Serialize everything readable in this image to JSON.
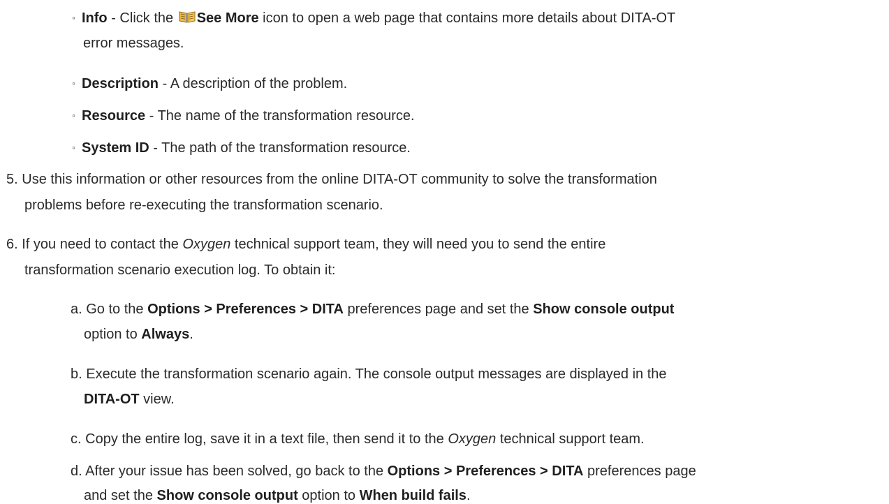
{
  "bullets": {
    "info": {
      "term": "Info",
      "pre": " - Click the ",
      "icon": "book-icon",
      "icon_label": "See More",
      "post1": " icon to open a web page that contains more details about DITA-OT",
      "post2": "error messages."
    },
    "description": {
      "term": "Description",
      "text": " - A description of the problem."
    },
    "resource": {
      "term": "Resource",
      "text": " - The name of the transformation resource."
    },
    "system_id": {
      "term": "System ID",
      "text": " - The path of the transformation resource."
    }
  },
  "step5": {
    "num": "5.",
    "line1": "Use this information or other resources from the online DITA-OT community to solve the transformation",
    "line2": "problems before re-executing the transformation scenario."
  },
  "step6": {
    "num": "6.",
    "l1_pre": "If you need to contact the ",
    "l1_em": "Oxygen",
    "l1_post": " technical support team, they will need you to send the entire",
    "line2": "transformation scenario execution log. To obtain it:"
  },
  "substeps": {
    "a": {
      "marker": "a.",
      "pre": "Go to the ",
      "menu": "Options > Preferences > DITA",
      "mid": " preferences page and set the ",
      "option": "Show console output",
      "l2_pre": "option to ",
      "value": "Always",
      "l2_post": "."
    },
    "b": {
      "marker": "b.",
      "line1": "Execute the transformation scenario again. The console output messages are displayed in the",
      "view": "DITA-OT",
      "l2_post": " view."
    },
    "c": {
      "marker": "c.",
      "pre": "Copy the entire log, save it in a text file, then send it to the ",
      "em": "Oxygen",
      "post": " technical support team."
    },
    "d": {
      "marker": "d.",
      "pre": "After your issue has been solved, go back to the ",
      "menu": "Options > Preferences > DITA",
      "post": " preferences page",
      "l2_pre": "and set the ",
      "option": "Show console output",
      "l2_mid": " option to ",
      "value": "When build fails",
      "l2_post": "."
    }
  }
}
